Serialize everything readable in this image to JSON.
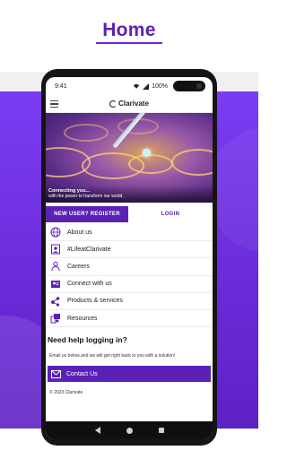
{
  "marketing": {
    "headline": "Home"
  },
  "status_bar": {
    "time": "9:41",
    "battery": "100%"
  },
  "app_bar": {
    "brand": "Clarivate"
  },
  "hero": {
    "title": "Connecting you...",
    "subtitle": "with the power to transform our world."
  },
  "auth": {
    "register_label": "NEW USER? REGISTER",
    "login_label": "LOGIN"
  },
  "menu": {
    "items": [
      {
        "label": "About us",
        "icon": "globe-icon"
      },
      {
        "label": "#LifeatClarivate",
        "icon": "person-card-icon"
      },
      {
        "label": "Careers",
        "icon": "briefcase-person-icon"
      },
      {
        "label": "Connect with us",
        "icon": "contact-card-icon"
      },
      {
        "label": "Products & services",
        "icon": "share-nodes-icon"
      },
      {
        "label": "Resources",
        "icon": "resources-icon"
      }
    ]
  },
  "help": {
    "title": "Need help logging in?",
    "text": "Email us below and we will get right back to you with a solution!"
  },
  "contact": {
    "label": "Contact Us",
    "icon": "mail-icon"
  },
  "footer": {
    "copyright": "© 2023 Clarivate"
  },
  "colors": {
    "accent": "#5b21b6",
    "background_purple": "#6d28d9"
  }
}
